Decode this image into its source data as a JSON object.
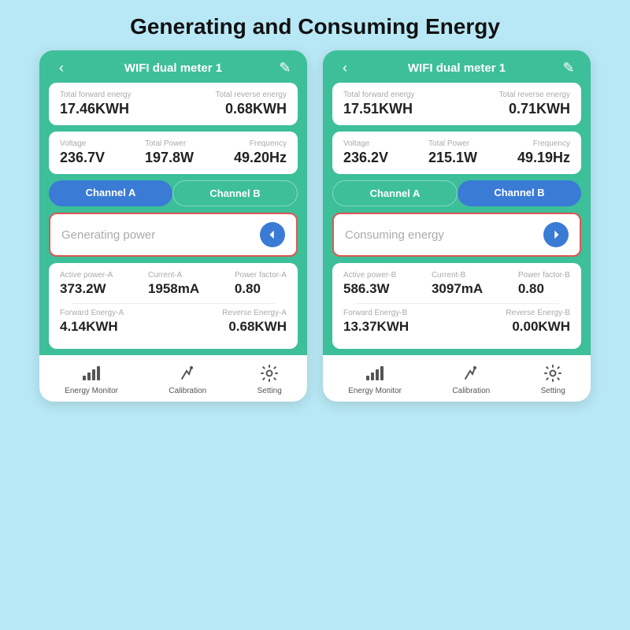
{
  "page": {
    "title": "Generating and Consuming Energy",
    "background": "#b8e8f5"
  },
  "phone_left": {
    "header": {
      "back_label": "‹",
      "title": "WIFI dual meter 1",
      "edit_label": "✎"
    },
    "total_energy": {
      "forward_label": "Total  forward energy",
      "forward_value": "17.46KWH",
      "reverse_label": "Total reverse energy",
      "reverse_value": "0.68KWH"
    },
    "stats": {
      "voltage_label": "Voltage",
      "voltage_value": "236.7V",
      "power_label": "Total Power",
      "power_value": "197.8W",
      "freq_label": "Frequency",
      "freq_value": "49.20Hz"
    },
    "channel_a_label": "Channel A",
    "channel_b_label": "Channel B",
    "active_channel": "A",
    "direction_label": "Generating power",
    "channel_data": {
      "active_power_label": "Active power-A",
      "active_power_value": "373.2W",
      "current_label": "Current-A",
      "current_value": "1958mA",
      "power_factor_label": "Power factor-A",
      "power_factor_value": "0.80",
      "forward_energy_label": "Forward Energy-A",
      "forward_energy_value": "4.14KWH",
      "reverse_energy_label": "Reverse Energy-A",
      "reverse_energy_value": "0.68KWH"
    },
    "footer": {
      "monitor_label": "Energy Monitor",
      "calibration_label": "Calibration",
      "setting_label": "Setting"
    }
  },
  "phone_right": {
    "header": {
      "back_label": "‹",
      "title": "WIFI dual meter 1",
      "edit_label": "✎"
    },
    "total_energy": {
      "forward_label": "Total  forward energy",
      "forward_value": "17.51KWH",
      "reverse_label": "Total reverse energy",
      "reverse_value": "0.71KWH"
    },
    "stats": {
      "voltage_label": "Voltage",
      "voltage_value": "236.2V",
      "power_label": "Total Power",
      "power_value": "215.1W",
      "freq_label": "Frequency",
      "freq_value": "49.19Hz"
    },
    "channel_a_label": "Channel A",
    "channel_b_label": "Channel B",
    "active_channel": "B",
    "direction_label": "Consuming energy",
    "channel_data": {
      "active_power_label": "Active power-B",
      "active_power_value": "586.3W",
      "current_label": "Current-B",
      "current_value": "3097mA",
      "power_factor_label": "Power factor-B",
      "power_factor_value": "0.80",
      "forward_energy_label": "Forward Energy-B",
      "forward_energy_value": "13.37KWH",
      "reverse_energy_label": "Reverse Energy-B",
      "reverse_energy_value": "0.00KWH"
    },
    "footer": {
      "monitor_label": "Energy Monitor",
      "calibration_label": "Calibration",
      "setting_label": "Setting"
    }
  }
}
